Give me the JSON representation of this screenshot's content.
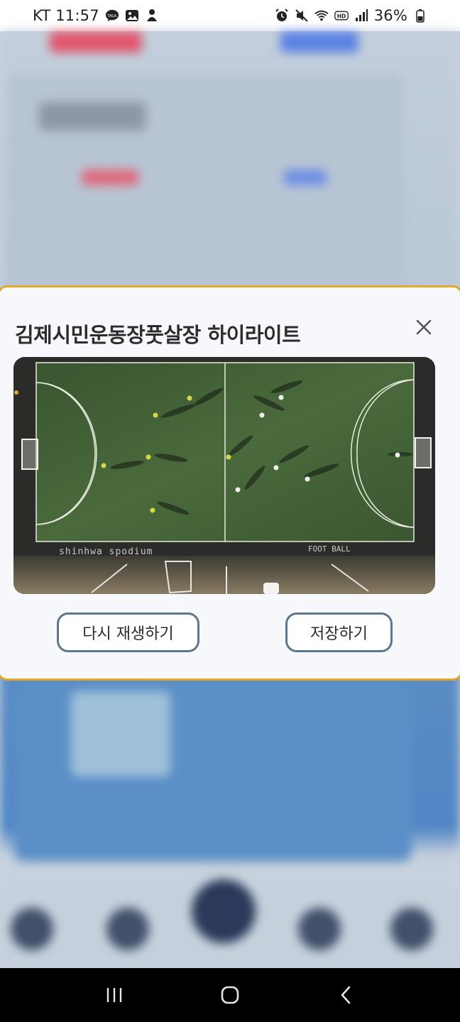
{
  "status_bar": {
    "carrier_time": "KT 11:57",
    "battery": "36%",
    "icons": [
      "talk-icon",
      "gallery-icon",
      "notification-icon",
      "alarm-icon",
      "mute-icon",
      "wifi-icon",
      "hd-icon",
      "signal-icon",
      "battery-icon"
    ]
  },
  "dialog": {
    "title": "김제시민운동장풋살장 하이라이트",
    "close_icon": "close-icon",
    "video": {
      "field_text_left": "shinhwa spodium",
      "field_text_right": "FOOT BALL"
    },
    "replay_label": "다시 재생하기",
    "save_label": "저장하기"
  },
  "nav_bar": {
    "items": [
      "recent-apps-icon",
      "home-icon",
      "back-icon"
    ]
  },
  "colors": {
    "dialog_border": "#e2a827",
    "button_border": "#5c778f",
    "pitch_green": "#3f5c33"
  }
}
